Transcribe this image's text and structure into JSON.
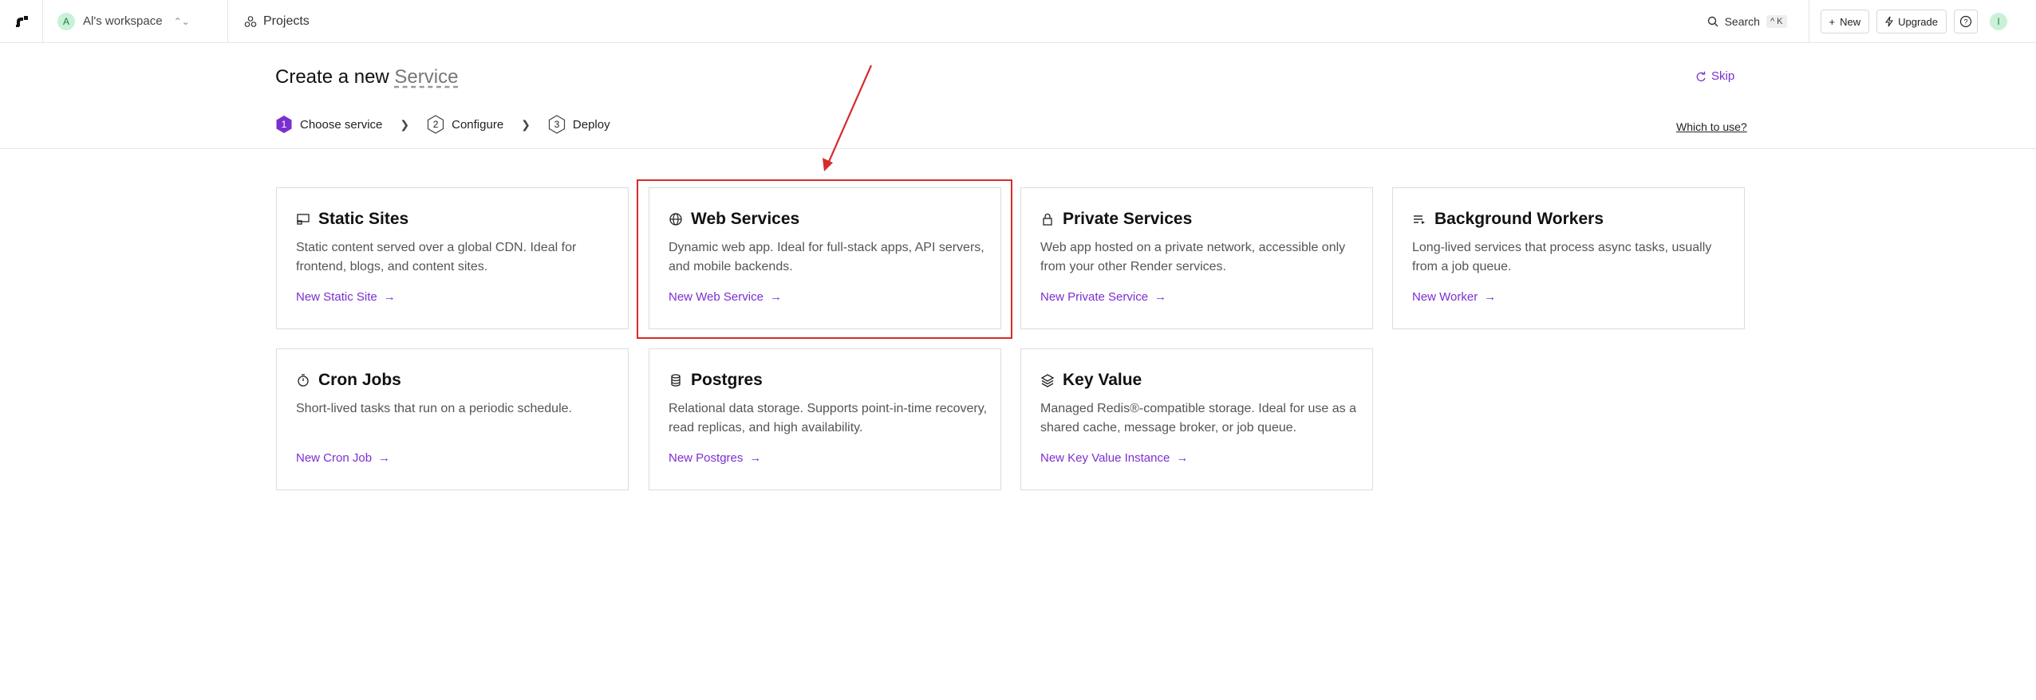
{
  "topbar": {
    "workspace_initial": "A",
    "workspace_name": "Al's workspace",
    "projects_label": "Projects",
    "search_label": "Search",
    "search_shortcut": "^ K",
    "new_label": "New",
    "upgrade_label": "Upgrade",
    "user_initial": "I"
  },
  "header": {
    "title_prefix": "Create a new",
    "title_service": "Service",
    "skip_label": "Skip",
    "which_label": "Which to use?",
    "steps": [
      {
        "number": "1",
        "label": "Choose service"
      },
      {
        "number": "2",
        "label": "Configure"
      },
      {
        "number": "3",
        "label": "Deploy"
      }
    ]
  },
  "cards": [
    {
      "title": "Static Sites",
      "icon": "monitor-icon",
      "desc": "Static content served over a global CDN. Ideal for frontend, blogs, and content sites.",
      "link": "New Static Site"
    },
    {
      "title": "Web Services",
      "icon": "globe-icon",
      "desc": "Dynamic web app. Ideal for full-stack apps, API servers, and mobile backends.",
      "link": "New Web Service"
    },
    {
      "title": "Private Services",
      "icon": "lock-icon",
      "desc": "Web app hosted on a private network, accessible only from your other Render services.",
      "link": "New Private Service"
    },
    {
      "title": "Background Workers",
      "icon": "list-icon",
      "desc": "Long-lived services that process async tasks, usually from a job queue.",
      "link": "New Worker"
    },
    {
      "title": "Cron Jobs",
      "icon": "timer-icon",
      "desc": "Short-lived tasks that run on a periodic schedule.",
      "link": "New Cron Job"
    },
    {
      "title": "Postgres",
      "icon": "database-icon",
      "desc": "Relational data storage. Supports point-in-time recovery, read replicas, and high availability.",
      "link": "New Postgres"
    },
    {
      "title": "Key Value",
      "icon": "layers-icon",
      "desc": "Managed Redis®-compatible storage. Ideal for use as a shared cache, message broker, or job queue.",
      "link": "New Key Value Instance"
    }
  ],
  "colors": {
    "accent": "#7b2fd0",
    "annotation": "#d92b2b"
  }
}
